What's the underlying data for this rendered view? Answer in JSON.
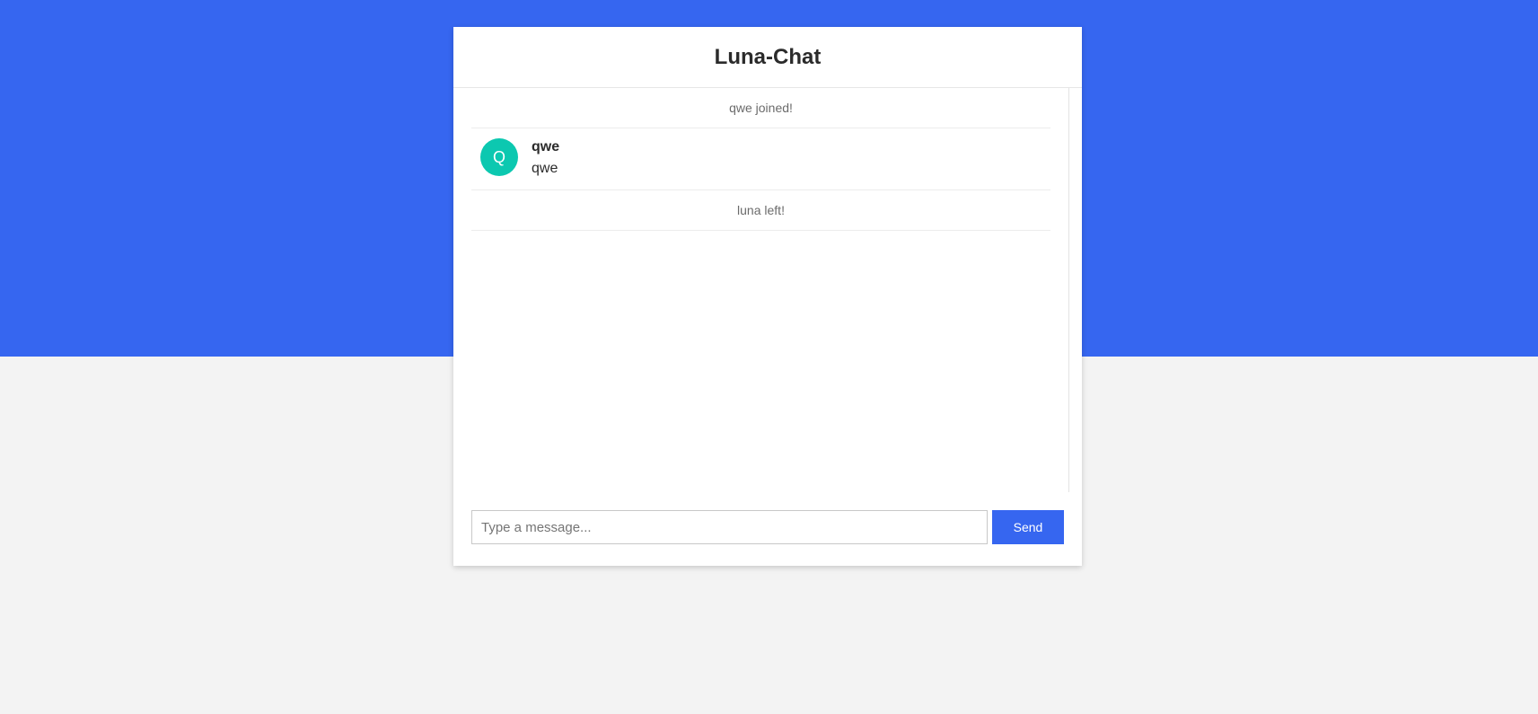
{
  "app": {
    "title": "Luna-Chat"
  },
  "colors": {
    "background_band": "#3666f0",
    "page_background": "#f3f3f3",
    "avatar": "#0cc8b0",
    "send_button": "#3666f0"
  },
  "messages": [
    {
      "kind": "system",
      "text": "qwe joined!"
    },
    {
      "kind": "user",
      "avatar_initial": "Q",
      "author": "qwe",
      "text": "qwe"
    },
    {
      "kind": "system",
      "text": "luna left!"
    }
  ],
  "composer": {
    "placeholder": "Type a message...",
    "value": "",
    "send_label": "Send"
  }
}
